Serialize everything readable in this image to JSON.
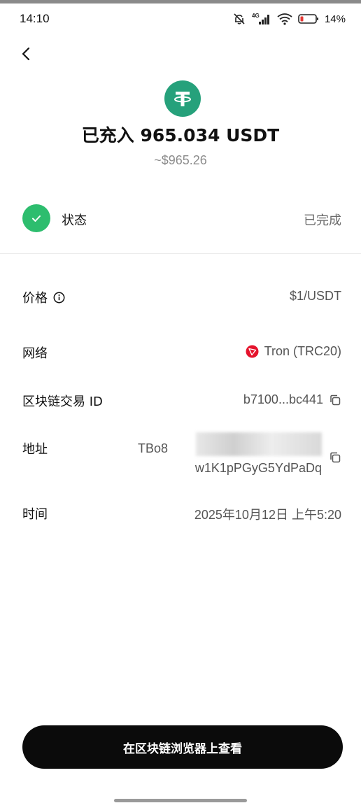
{
  "status_bar": {
    "time": "14:10",
    "network": "4G",
    "battery": "14%",
    "icons": [
      "mute-icon",
      "signal-icon",
      "wifi-icon",
      "battery-icon"
    ]
  },
  "nav": {
    "back_icon": "chevron-left-icon"
  },
  "header": {
    "token_icon": "usdt-tether-icon",
    "token_color": "#26a17b",
    "headline": "已充入 965.034  USDT",
    "usd_value": "~$965.26"
  },
  "status": {
    "label": "状态",
    "value": "已完成",
    "icon": "checkmark-icon",
    "color": "#2dbd6e"
  },
  "details": {
    "price": {
      "label": "价格",
      "value": "$1/USDT",
      "info_icon": "info-icon"
    },
    "network": {
      "label": "网络",
      "value": "Tron (TRC20)",
      "network_icon": "tron-icon",
      "network_color": "#e5132c"
    },
    "tx_id": {
      "label": "区块链交易 ID",
      "value": "b7100...bc441"
    },
    "address": {
      "label": "地址",
      "line1": "TBo8",
      "line2": "w1K1pPGyG5YdPaDq"
    },
    "time": {
      "label": "时间",
      "value": "2025年10月12日 上午5:20"
    }
  },
  "actions": {
    "view_on_explorer": "在区块链浏览器上查看"
  }
}
